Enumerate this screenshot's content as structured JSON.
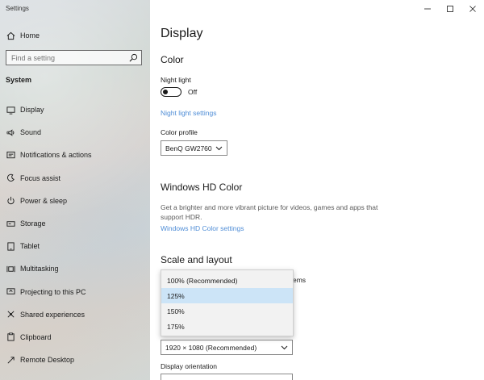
{
  "window": {
    "title": "Settings",
    "controls": {
      "minimize": "—",
      "maximize": "☐",
      "close": "✕"
    }
  },
  "sidebar": {
    "home": "Home",
    "search_placeholder": "Find a setting",
    "section": "System",
    "items": [
      {
        "label": "Display",
        "icon": "display-icon"
      },
      {
        "label": "Sound",
        "icon": "sound-icon"
      },
      {
        "label": "Notifications & actions",
        "icon": "notifications-icon"
      },
      {
        "label": "Focus assist",
        "icon": "focus-assist-icon"
      },
      {
        "label": "Power & sleep",
        "icon": "power-icon"
      },
      {
        "label": "Storage",
        "icon": "storage-icon"
      },
      {
        "label": "Tablet",
        "icon": "tablet-icon"
      },
      {
        "label": "Multitasking",
        "icon": "multitasking-icon"
      },
      {
        "label": "Projecting to this PC",
        "icon": "projecting-icon"
      },
      {
        "label": "Shared experiences",
        "icon": "shared-experiences-icon"
      },
      {
        "label": "Clipboard",
        "icon": "clipboard-icon"
      },
      {
        "label": "Remote Desktop",
        "icon": "remote-desktop-icon"
      }
    ]
  },
  "main": {
    "title": "Display",
    "color": {
      "heading": "Color",
      "night_light_label": "Night light",
      "night_light_state": "Off",
      "night_light_settings_link": "Night light settings",
      "color_profile_label": "Color profile",
      "color_profile_value": "BenQ GW2760"
    },
    "hd_color": {
      "heading": "Windows HD Color",
      "description": "Get a brighter and more vibrant picture for videos, games and apps that support HDR.",
      "settings_link": "Windows HD Color settings"
    },
    "scale": {
      "heading": "Scale and layout",
      "behind_text_fragment": "ems",
      "options": [
        "100% (Recommended)",
        "125%",
        "150%",
        "175%"
      ],
      "highlighted_option": "125%",
      "resolution_value": "1920 × 1080 (Recommended)",
      "orientation_label": "Display orientation"
    }
  },
  "colors": {
    "accent_link": "#4f8dd6",
    "dropdown_highlight": "#cce4f7"
  }
}
